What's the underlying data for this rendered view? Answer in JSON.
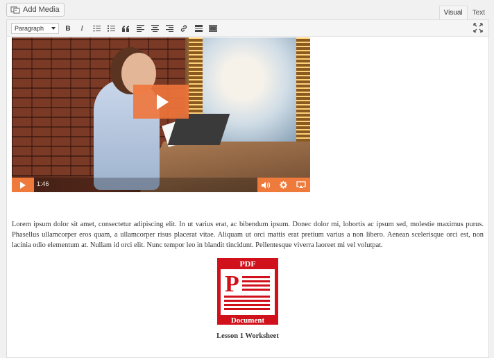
{
  "top": {
    "add_media_label": "Add Media",
    "tabs": [
      {
        "label": "Visual",
        "active": true
      },
      {
        "label": "Text",
        "active": false
      }
    ]
  },
  "toolbar": {
    "format_value": "Paragraph",
    "buttons": [
      "bold",
      "italic",
      "bulleted-list",
      "numbered-list",
      "blockquote",
      "align-left",
      "align-center",
      "align-right",
      "link",
      "read-more",
      "toolbar-toggle"
    ],
    "bold_label": "B",
    "italic_label": "I"
  },
  "video": {
    "duration": "1:46",
    "accent_color": "#ee7a3c"
  },
  "body": {
    "paragraph": "Lorem ipsum dolor sit amet, consectetur adipiscing elit. In ut varius erat, ac bibendum ipsum. Donec dolor mi, lobortis ac ipsum sed, molestie maximus purus. Phasellus ullamcorper eros quam, a ullamcorper risus placerat vitae. Aliquam ut orci mattis erat pretium varius a non libero. Aenean scelerisque orci est, non lacinia odio elementum at. Nullam id orci elit. Nunc tempor leo in blandit tincidunt. Pellentesque viverra laoreet mi vel volutpat.",
    "pdf_top_label": "PDF",
    "pdf_bottom_label": "Document",
    "pdf_color": "#d0111b",
    "caption": "Lesson 1 Worksheet"
  }
}
